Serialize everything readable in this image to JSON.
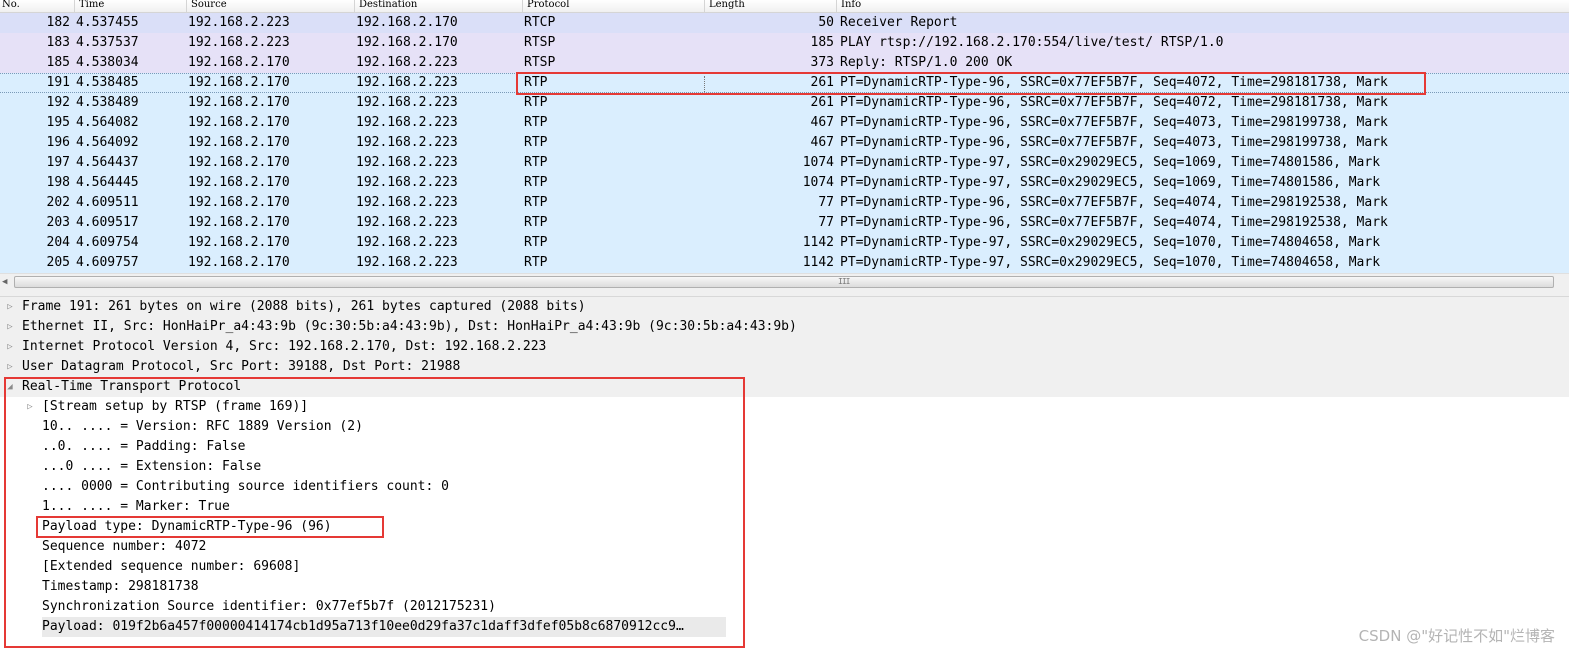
{
  "columns": [
    "No.",
    "Time",
    "Source",
    "Destination",
    "Protocol",
    "Length",
    "Info"
  ],
  "packets": [
    {
      "no": "182",
      "time": "4.537455",
      "source": "192.168.2.223",
      "destination": "192.168.2.170",
      "protocol": "RTCP",
      "length": "50",
      "info": "Receiver Report"
    },
    {
      "no": "183",
      "time": "4.537537",
      "source": "192.168.2.223",
      "destination": "192.168.2.170",
      "protocol": "RTSP",
      "length": "185",
      "info": "PLAY rtsp://192.168.2.170:554/live/test/ RTSP/1.0"
    },
    {
      "no": "185",
      "time": "4.538034",
      "source": "192.168.2.170",
      "destination": "192.168.2.223",
      "protocol": "RTSP",
      "length": "373",
      "info": "Reply: RTSP/1.0 200 OK"
    },
    {
      "no": "191",
      "time": "4.538485",
      "source": "192.168.2.170",
      "destination": "192.168.2.223",
      "protocol": "RTP",
      "length": "261",
      "info": "PT=DynamicRTP-Type-96, SSRC=0x77EF5B7F, Seq=4072, Time=298181738, Mark"
    },
    {
      "no": "192",
      "time": "4.538489",
      "source": "192.168.2.170",
      "destination": "192.168.2.223",
      "protocol": "RTP",
      "length": "261",
      "info": "PT=DynamicRTP-Type-96, SSRC=0x77EF5B7F, Seq=4072, Time=298181738, Mark"
    },
    {
      "no": "195",
      "time": "4.564082",
      "source": "192.168.2.170",
      "destination": "192.168.2.223",
      "protocol": "RTP",
      "length": "467",
      "info": "PT=DynamicRTP-Type-96, SSRC=0x77EF5B7F, Seq=4073, Time=298199738, Mark"
    },
    {
      "no": "196",
      "time": "4.564092",
      "source": "192.168.2.170",
      "destination": "192.168.2.223",
      "protocol": "RTP",
      "length": "467",
      "info": "PT=DynamicRTP-Type-96, SSRC=0x77EF5B7F, Seq=4073, Time=298199738, Mark"
    },
    {
      "no": "197",
      "time": "4.564437",
      "source": "192.168.2.170",
      "destination": "192.168.2.223",
      "protocol": "RTP",
      "length": "1074",
      "info": "PT=DynamicRTP-Type-97, SSRC=0x29029EC5, Seq=1069, Time=74801586, Mark"
    },
    {
      "no": "198",
      "time": "4.564445",
      "source": "192.168.2.170",
      "destination": "192.168.2.223",
      "protocol": "RTP",
      "length": "1074",
      "info": "PT=DynamicRTP-Type-97, SSRC=0x29029EC5, Seq=1069, Time=74801586, Mark"
    },
    {
      "no": "202",
      "time": "4.609511",
      "source": "192.168.2.170",
      "destination": "192.168.2.223",
      "protocol": "RTP",
      "length": "77",
      "info": "PT=DynamicRTP-Type-96, SSRC=0x77EF5B7F, Seq=4074, Time=298192538, Mark"
    },
    {
      "no": "203",
      "time": "4.609517",
      "source": "192.168.2.170",
      "destination": "192.168.2.223",
      "protocol": "RTP",
      "length": "77",
      "info": "PT=DynamicRTP-Type-96, SSRC=0x77EF5B7F, Seq=4074, Time=298192538, Mark"
    },
    {
      "no": "204",
      "time": "4.609754",
      "source": "192.168.2.170",
      "destination": "192.168.2.223",
      "protocol": "RTP",
      "length": "1142",
      "info": "PT=DynamicRTP-Type-97, SSRC=0x29029EC5, Seq=1070, Time=74804658, Mark"
    },
    {
      "no": "205",
      "time": "4.609757",
      "source": "192.168.2.170",
      "destination": "192.168.2.223",
      "protocol": "RTP",
      "length": "1142",
      "info": "PT=DynamicRTP-Type-97, SSRC=0x29029EC5, Seq=1070, Time=74804658, Mark"
    }
  ],
  "selected_packet_no": "191",
  "row_colors": {
    "RTCP": "#dadff8",
    "RTSP": "#e6e1f7",
    "RTP": "#daeefe"
  },
  "scrollbar": {
    "grip_glyph": "III",
    "left_arrow_glyph": "◀"
  },
  "details": [
    {
      "text": "Frame 191: 261 bytes on wire (2088 bits), 261 bytes captured (2088 bits)",
      "level": 0,
      "expander": "collapsed"
    },
    {
      "text": "Ethernet II, Src: HonHaiPr_a4:43:9b (9c:30:5b:a4:43:9b), Dst: HonHaiPr_a4:43:9b (9c:30:5b:a4:43:9b)",
      "level": 0,
      "expander": "collapsed"
    },
    {
      "text": "Internet Protocol Version 4, Src: 192.168.2.170, Dst: 192.168.2.223",
      "level": 0,
      "expander": "collapsed"
    },
    {
      "text": "User Datagram Protocol, Src Port: 39188, Dst Port: 21988",
      "level": 0,
      "expander": "collapsed"
    },
    {
      "text": "Real-Time Transport Protocol",
      "level": 0,
      "expander": "expanded"
    },
    {
      "text": "[Stream setup by RTSP (frame 169)]",
      "level": 1,
      "expander": "collapsed"
    },
    {
      "text": "10.. .... = Version: RFC 1889 Version (2)",
      "level": 1,
      "expander": "none"
    },
    {
      "text": "..0. .... = Padding: False",
      "level": 1,
      "expander": "none"
    },
    {
      "text": "...0 .... = Extension: False",
      "level": 1,
      "expander": "none"
    },
    {
      "text": ".... 0000 = Contributing source identifiers count: 0",
      "level": 1,
      "expander": "none"
    },
    {
      "text": "1... .... = Marker: True",
      "level": 1,
      "expander": "none"
    },
    {
      "text": "Payload type: DynamicRTP-Type-96 (96)",
      "level": 1,
      "expander": "none"
    },
    {
      "text": "Sequence number: 4072",
      "level": 1,
      "expander": "none"
    },
    {
      "text": "[Extended sequence number: 69608]",
      "level": 1,
      "expander": "none"
    },
    {
      "text": "Timestamp: 298181738",
      "level": 1,
      "expander": "none"
    },
    {
      "text": "Synchronization Source identifier: 0x77ef5b7f (2012175231)",
      "level": 1,
      "expander": "none"
    },
    {
      "text": "Payload: 019f2b6a457f00000414174cb1d95a713f10ee0d29fa37c1daff3dfef05b8c6870912cc9…",
      "level": 1,
      "expander": "none"
    }
  ],
  "annotation_color": "#e53935",
  "watermark": "CSDN @\"好记性不如\"烂博客"
}
